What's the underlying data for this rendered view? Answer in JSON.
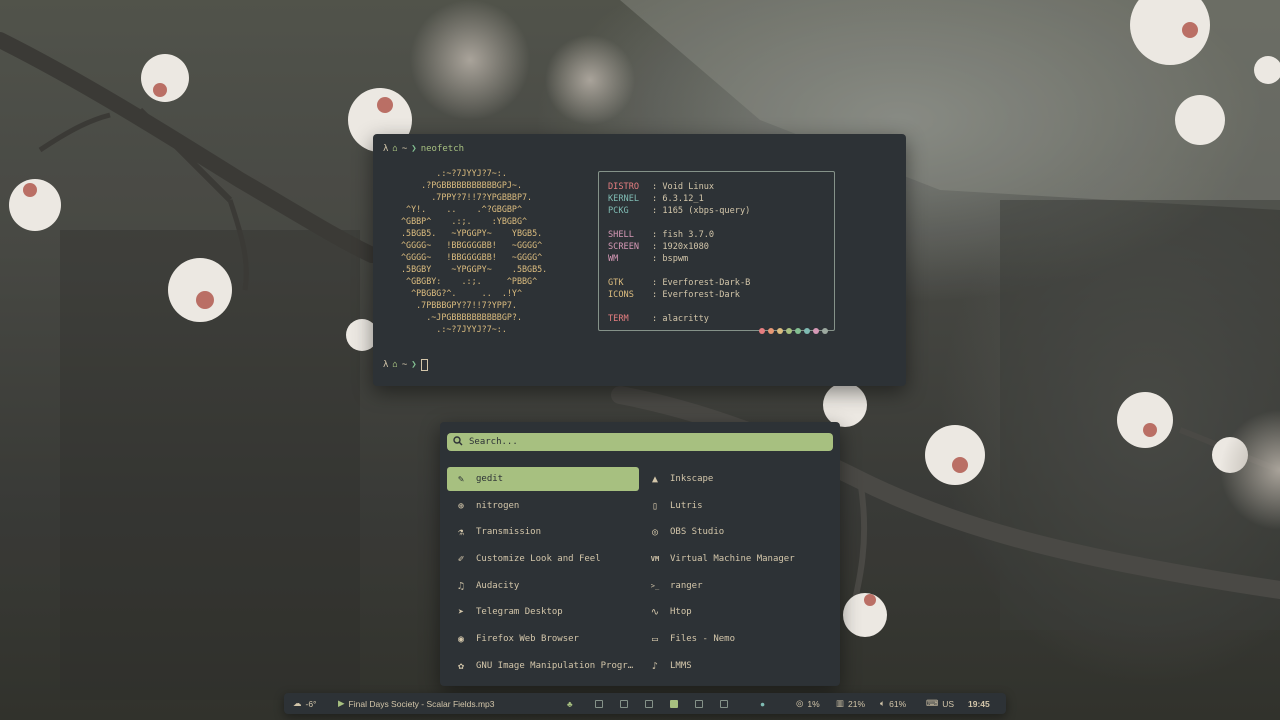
{
  "terminal": {
    "prompt_symbol": "λ",
    "prompt_path": "~",
    "prompt_arrow": "❯",
    "command": "neofetch",
    "ascii_art": "       .:~?7JYYJ?7~:.\n    .?PGBBBBBBBBBBBGPJ~.\n      .7PPY?7!!7?YPGBBBP7.\n ^Y!.    ..    .^?GBGBP^\n^GBBP^    .:;.    :YBGBG^\n.5BGB5.   ~YPGGPY~    YBGB5.\n^GGGG~   !BBGGGGBB!   ~GGGG^\n^GGGG~   !BBGGGGBB!   ~GGGG^\n.5BGBY    ~YPGGPY~    .5BGB5.\n ^GBGBY:    .:;.     ^PBBG^\n  ^PBGBG?^.     ..  .!Y^\n   .7PBBBGPY?7!!7?YPP7.\n     .~JPGBBBBBBBBBBGP?.\n       .:~?7JYYJ?7~:.",
    "info": [
      {
        "key": "DISTRO",
        "value": ": Void Linux",
        "color": "red"
      },
      {
        "key": "KERNEL",
        "value": ": 6.3.12_1",
        "color": "blue"
      },
      {
        "key": "PCKG",
        "value": ": 1165 (xbps-query)",
        "color": "blue"
      },
      {
        "key": "SHELL",
        "value": ": fish 3.7.0",
        "color": "purple"
      },
      {
        "key": "SCREEN",
        "value": ": 1920x1080",
        "color": "purple"
      },
      {
        "key": "WM",
        "value": ": bspwm",
        "color": "purple"
      },
      {
        "key": "GTK",
        "value": ": Everforest-Dark-B",
        "color": "yellow"
      },
      {
        "key": "ICONS",
        "value": ": Everforest-Dark",
        "color": "yellow"
      },
      {
        "key": "TERM",
        "value": ": alacritty",
        "color": "red"
      }
    ],
    "palette": [
      "#e67e80",
      "#e69875",
      "#dbbc7f",
      "#a7c080",
      "#83c092",
      "#7fbbb3",
      "#d699b6",
      "#9da9a0"
    ]
  },
  "launcher": {
    "search_placeholder": "Search...",
    "apps": [
      {
        "label": "gedit",
        "icon": "text-editor-icon",
        "glyph": "✎",
        "selected": true
      },
      {
        "label": "Inkscape",
        "icon": "inkscape-icon",
        "glyph": "▲"
      },
      {
        "label": "nitrogen",
        "icon": "wallpaper-icon",
        "glyph": "⊕"
      },
      {
        "label": "Lutris",
        "icon": "lutris-icon",
        "glyph": "▯"
      },
      {
        "label": "Transmission",
        "icon": "transmission-icon",
        "glyph": "⚗"
      },
      {
        "label": "OBS Studio",
        "icon": "obs-icon",
        "glyph": "◎"
      },
      {
        "label": "Customize Look and Feel",
        "icon": "brush-icon",
        "glyph": "✐"
      },
      {
        "label": "Virtual Machine Manager",
        "icon": "vm-icon",
        "glyph": "VM"
      },
      {
        "label": "Audacity",
        "icon": "headphones-icon",
        "glyph": "♫"
      },
      {
        "label": "ranger",
        "icon": "terminal-icon",
        "glyph": ">_"
      },
      {
        "label": "Telegram Desktop",
        "icon": "telegram-icon",
        "glyph": "➤"
      },
      {
        "label": "Htop",
        "icon": "monitor-icon",
        "glyph": "∿"
      },
      {
        "label": "Firefox Web Browser",
        "icon": "firefox-icon",
        "glyph": "◉"
      },
      {
        "label": "Files - Nemo",
        "icon": "folder-icon",
        "glyph": "▭"
      },
      {
        "label": "GNU Image Manipulation Progr…",
        "icon": "gimp-icon",
        "glyph": "✿"
      },
      {
        "label": "LMMS",
        "icon": "lmms-icon",
        "glyph": "♪"
      }
    ]
  },
  "bar": {
    "weather": "-6°",
    "music": "Final Days Society - Scalar Fields.mp3",
    "workspaces": [
      false,
      false,
      false,
      true,
      false,
      false
    ],
    "cpu": "1%",
    "memory": "21%",
    "volume": "61%",
    "keyboard": "US",
    "time": "19:45"
  }
}
